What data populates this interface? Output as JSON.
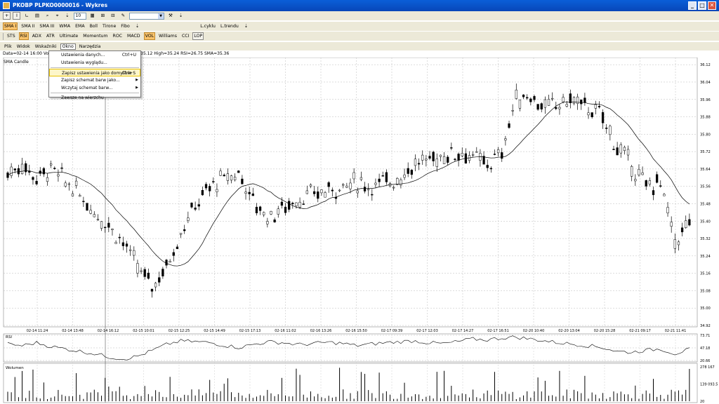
{
  "window": {
    "title": "PKOBP PLPKO0000016 - Wykres",
    "min": "_",
    "max": "□",
    "close": "✕"
  },
  "toolbar1": {
    "icons": [
      "+",
      "I",
      "∟",
      "▤",
      "⌕",
      "⌖",
      "⇣"
    ],
    "number_value": "10",
    "icons2": [
      "▦",
      "⊞",
      "⊟",
      "✎"
    ],
    "dropdown_value": "",
    "icons3": [
      "⚒",
      "⇣"
    ]
  },
  "toolbar2": {
    "indicators": [
      "SMA I",
      "SMA II",
      "SMA III",
      "WMA",
      "EMA",
      "Boll",
      "Tirone",
      "Fibo"
    ],
    "active": "SMA I",
    "expand": "⇣",
    "right_items": [
      "L.cyklu",
      "L.trendu"
    ],
    "right_expand": "⇣"
  },
  "toolbar3": {
    "indicators": [
      "STS",
      "RSI",
      "ADX",
      "ATR",
      "Ultimate",
      "Momentum",
      "ROC",
      "MACD",
      "VOL",
      "Williams",
      "CCI",
      "LOP"
    ],
    "active": [
      "RSI",
      "VOL"
    ],
    "boxed": "LOP"
  },
  "menubar": {
    "items": [
      "Plik",
      "Widok",
      "Wskaźniki",
      "Okno",
      "Narzędzia"
    ],
    "open": "Okno"
  },
  "infoline": {
    "left": "Data=02-14 16:00 Volum",
    "right": "ow=35.12  High=35.24  RSI=26.75  SMA=35.36"
  },
  "legend": "SMA  Candle",
  "okno_menu": [
    {
      "label": "Ustawienia danych...",
      "shortcut": "Ctrl+U"
    },
    {
      "label": "Ustawienia wyglądu...",
      "shortcut": ""
    },
    {
      "separator": true
    },
    {
      "label": "Zapisz ustawienia jako domyślne",
      "shortcut": "Ctrl+S",
      "highlight": true
    },
    {
      "label": "Zapisz schemat barw jako...",
      "shortcut": "",
      "submenu": true
    },
    {
      "label": "Wczytaj schemat barw...",
      "shortcut": "",
      "submenu": true
    },
    {
      "separator": true
    },
    {
      "label": "Zawsze na wierzchu",
      "shortcut": ""
    }
  ],
  "chart_data": {
    "type": "candlestick",
    "series_name": "Candle",
    "overlay": "SMA",
    "y_ticks": [
      "36.12",
      "36.04",
      "35.96",
      "35.88",
      "35.80",
      "35.72",
      "35.64",
      "35.56",
      "35.48",
      "35.40",
      "35.32",
      "35.24",
      "35.16",
      "35.08",
      "35.00",
      "34.92"
    ],
    "ylim": [
      34.92,
      36.14
    ],
    "x_ticks": [
      "02-14 11:24",
      "02-14 13:48",
      "02-14 16:12",
      "02-15 10:01",
      "02-15 12:25",
      "02-15 14:49",
      "02-15 17:13",
      "02-16 11:02",
      "02-16 13:26",
      "02-16 15:50",
      "02-17 09:39",
      "02-17 12:03",
      "02-17 14:27",
      "02-17 16:51",
      "02-20 10:40",
      "02-20 13:04",
      "02-20 15:28",
      "02-21 09:17",
      "02-21 11:41"
    ],
    "close_trend": [
      35.62,
      35.66,
      35.6,
      35.64,
      35.58,
      35.52,
      35.44,
      35.38,
      35.3,
      35.18,
      35.1,
      35.2,
      35.36,
      35.48,
      35.56,
      35.6,
      35.62,
      35.48,
      35.42,
      35.46,
      35.5,
      35.52,
      35.54,
      35.56,
      35.58,
      35.56,
      35.58,
      35.6,
      35.66,
      35.68,
      35.7,
      35.72,
      35.7,
      35.66,
      35.7,
      35.96,
      35.98,
      35.92,
      35.94,
      35.96,
      35.92,
      35.88,
      35.74,
      35.66,
      35.56,
      35.58,
      35.3,
      35.4
    ],
    "rsi": {
      "label": "RSI",
      "y_ticks": [
        "73.71",
        "47.18",
        "20.66"
      ],
      "values": [
        55,
        52,
        58,
        50,
        45,
        40,
        35,
        28,
        24,
        30,
        42,
        55,
        62,
        60,
        58,
        52,
        48,
        55,
        60,
        58,
        54,
        56,
        59,
        57,
        52,
        55,
        58,
        60,
        62,
        58,
        56,
        60,
        66,
        64,
        68,
        70,
        66,
        62,
        58,
        55,
        52,
        48,
        40,
        38,
        42,
        45,
        35,
        44
      ]
    },
    "volume": {
      "label": "Wolumen",
      "y_ticks": [
        "278 167",
        "139 093.5",
        "20"
      ],
      "ylim": [
        0,
        278167
      ]
    }
  }
}
